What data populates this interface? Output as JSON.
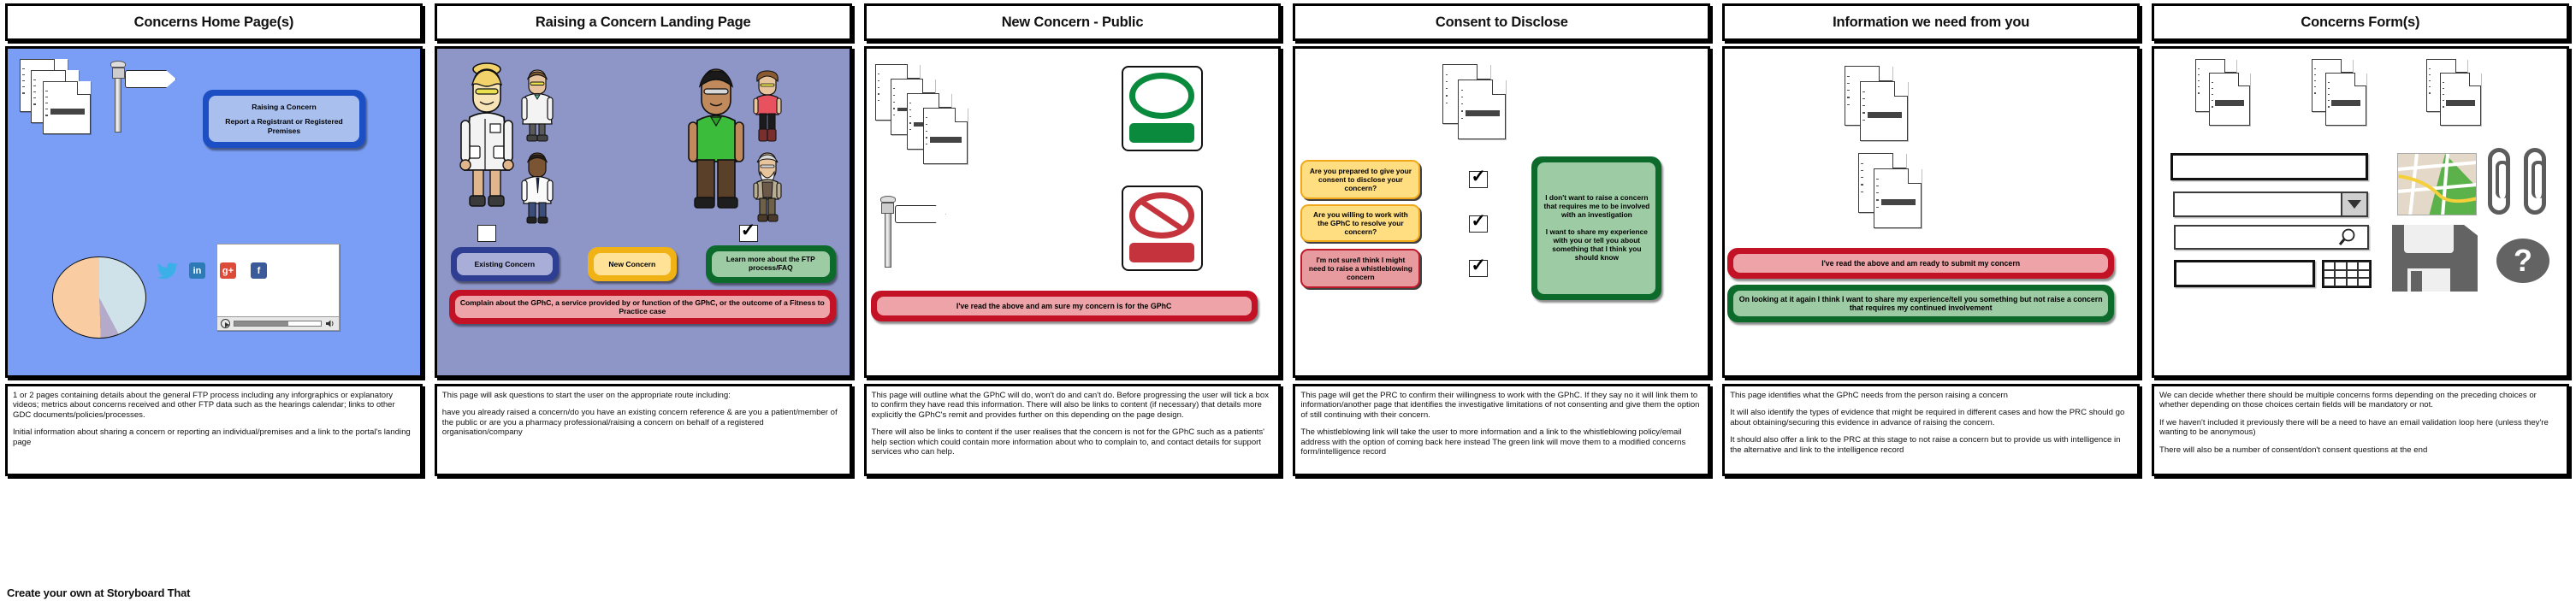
{
  "footer": {
    "text": "Create your own at Storyboard That"
  },
  "panels": [
    {
      "title": "Concerns Home Page(s)",
      "scene": {
        "primary_button": {
          "line1": "Raising a Concern",
          "line2": "Report a Registrant or Registered Premises"
        },
        "icons": [
          "documents-stack-icon",
          "signpost-icon",
          "pie-chart-icon",
          "video-player-icon"
        ],
        "social": [
          "twitter-icon",
          "linkedin-icon",
          "google-plus-icon",
          "facebook-icon"
        ],
        "social_labels": {
          "twitter": "",
          "linkedin": "in",
          "googleplus": "g+",
          "facebook": "f"
        }
      },
      "caption": [
        "1 or 2 pages containing details about the general FTP process including any inforgraphics or explanatory videos; metrics about concerns received and other FTP data such as the hearings calendar; links to other GDC documents/policies/processes.",
        "Initial information about sharing a concern or reporting an individual/premises and a link to the portal's landing page"
      ]
    },
    {
      "title": "Raising a Concern Landing Page",
      "scene": {
        "buttons": [
          {
            "label": "Existing Concern",
            "color": "#2e3f93"
          },
          {
            "label": "New Concern",
            "color": "#f0b215"
          },
          {
            "label": "Learn more about the FTP process/FAQ",
            "color": "#0c6b2b"
          },
          {
            "label": "Complain about the GPhC, a service provided by or function of the GPhC, or the outcome of a Fitness to Practice case",
            "color": "#c31125"
          }
        ],
        "checkbox_left_checked": false,
        "checkbox_right_checked": true,
        "characters": [
          "pharmacist-woman",
          "pharmacist-man",
          "staff-man",
          "patient-man",
          "patient-woman",
          "elderly-man"
        ]
      },
      "caption": [
        "This page will ask questions to start the user on the appropriate route including:",
        "have you already raised a concern/do you have an existing concern reference & are you a patient/member of the public or are you a pharmacy professional/raising a concern on behalf of a registered organisation/company"
      ]
    },
    {
      "title": "New Concern - Public",
      "scene": {
        "icons": [
          "documents-stack-icon",
          "signpost-icon",
          "green-allowed-sign-icon",
          "red-prohibited-sign-icon"
        ],
        "buttons": [
          {
            "label": "I've read the above and am sure my concern is for the GPhC",
            "color": "#c31125"
          }
        ]
      },
      "caption": [
        "This page will outline what the GPhC will do, won't do and can't do. Before progressing the user will tick a box to confirm they have read this information. There will also be links to content (if necessary) that details more explicitly the GPhC's remit and provides further on this depending on the page design.",
        "There will also be links to content if the user realises that the concern is not for the GPhC such as a patients' help section which could contain more information about who to complain to, and contact details for support services who can help."
      ]
    },
    {
      "title": "Consent to Disclose",
      "scene": {
        "badges": [
          {
            "label": "Are you prepared to give your consent to disclose your concern?",
            "color": "#ffdd81"
          },
          {
            "label": "Are you willing to work with the GPhC to resolve your concern?",
            "color": "#ffdd81"
          },
          {
            "label": "I'm not sure/I think I might need to raise a whistleblowing concern",
            "color": "#e79b9f"
          }
        ],
        "checkboxes": [
          true,
          true,
          true
        ],
        "green_panel": {
          "line1": "I don't want to raise a concern that requires me to be involved with an investigation",
          "line2": "I want to share my experience with you or tell you about something that I think you should know"
        },
        "icons": [
          "documents-stack-icon"
        ]
      },
      "caption": [
        "This page will get the PRC to confirm their willingness to work with the GPhC. If they say no it will link them to information/another page that identifies the investigative limitations of not consenting and give them the option of still continuing with their concern.",
        "The whistleblowing link will take the user to more information and a link to the whistleblowing policy/email address with the option of coming back here instead The green link will move them to a modified concerns form/intelligence record"
      ]
    },
    {
      "title": "Information we need from you",
      "scene": {
        "icons": [
          "documents-stack-icon",
          "documents-stack-icon"
        ],
        "buttons": [
          {
            "label": "I've read the above and am ready to submit my concern",
            "color": "#c31125"
          },
          {
            "label": "On looking at it again I think I want to share my experience/tell you something but not raise a concern that requires my continued involvement",
            "color": "#0c6b2b"
          }
        ]
      },
      "caption": [
        "This page identifies what the GPhC needs from the person raising a concern",
        "It will also identify the types of evidence that might be required in different cases and how the PRC should go about obtaining/securing this evidence in advance of raising the concern.",
        "It should also offer a link to the PRC at this stage to not raise a concern but to provide us with intelligence in the alternative and link to the intelligence record"
      ]
    },
    {
      "title": "Concerns Form(s)",
      "scene": {
        "icons": [
          "documents-stack-icon",
          "documents-stack-icon",
          "documents-stack-icon",
          "map-icon",
          "paperclip-icon",
          "paperclip-icon",
          "floppy-disk-save-icon",
          "question-mark-icon",
          "magnifier-icon",
          "table-grid-icon",
          "dropdown-arrow-icon"
        ],
        "fields": [
          {
            "name": "text-field",
            "value": "",
            "placeholder": ""
          },
          {
            "name": "dropdown-field",
            "value": "",
            "placeholder": ""
          },
          {
            "name": "search-field",
            "value": "",
            "placeholder": ""
          },
          {
            "name": "date-field",
            "value": "",
            "placeholder": ""
          }
        ],
        "help_glyph": "?"
      },
      "caption": [
        "We can decide whether there should be multiple concerns forms depending on the preceding choices or whether depending on those choices certain fields will be mandatory or not.",
        "If we haven't included it previously there will be a need to have an email validation loop here (unless they're wanting to be anonymous)",
        "There will also be a number of consent/don't consent questions at the end"
      ]
    }
  ]
}
